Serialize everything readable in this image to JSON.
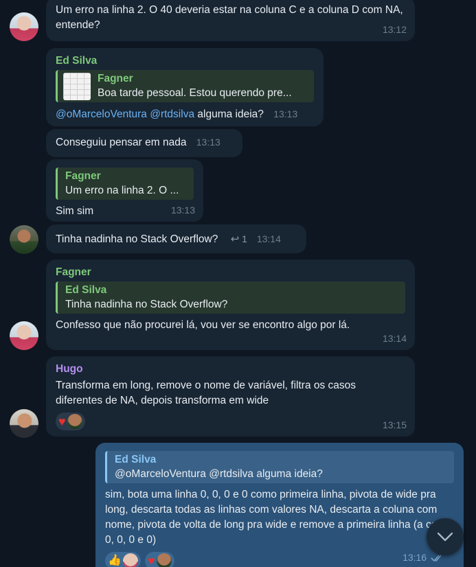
{
  "messages": [
    {
      "id": "m1",
      "text": "Um erro na linha 2. O 40 deveria estar na coluna C e a coluna D com NA, entende?",
      "time": "13:12"
    },
    {
      "id": "m2",
      "sender": "Ed Silva",
      "reply_name": "Fagner",
      "reply_text": "Boa tarde pessoal. Estou querendo pre...",
      "mention1": "@oMarceloVentura",
      "mention2": "@rtdsilva",
      "text": "alguma ideia?",
      "time": "13:13"
    },
    {
      "id": "m3",
      "text": "Conseguiu pensar em nada",
      "time": "13:13"
    },
    {
      "id": "m4",
      "reply_name": "Fagner",
      "reply_text": "Um erro na linha 2. O ...",
      "text": "Sim sim",
      "time": "13:13"
    },
    {
      "id": "m5",
      "text": "Tinha nadinha no Stack Overflow?",
      "reply_count": "1",
      "time": "13:14"
    },
    {
      "id": "m6",
      "sender": "Fagner",
      "reply_name": "Ed Silva",
      "reply_text": "Tinha nadinha no Stack Overflow?",
      "text": "Confesso que não procurei lá, vou ver se encontro algo por lá.",
      "time": "13:14"
    },
    {
      "id": "m7",
      "sender": "Hugo",
      "text": "Transforma em long, remove o nome de variável, filtra os casos diferentes de NA, depois transforma em wide",
      "reaction": "heart",
      "time": "13:15"
    },
    {
      "id": "m8",
      "reply_name": "Ed Silva",
      "reply_text": "@oMarceloVentura @rtdsilva alguma ideia?",
      "text": "sim, bota uma linha 0, 0, 0 e 0 como primeira linha, pivota de wide pra long, descarta todas as linhas com valores NA, descarta a coluna com nome, pivota de volta de long pra wide e remove a primeira linha (a com 0, 0, 0 e 0)",
      "time": "13:16"
    }
  ],
  "icons": {
    "reply_arrow": "reply-arrow-icon",
    "heart": "heart-icon",
    "thumbs_up": "thumbs-up-icon",
    "scroll_down": "chevron-down-icon",
    "read": "double-check-icon"
  },
  "colors": {
    "background": "#0e1621",
    "incoming_bubble": "#182533",
    "outgoing_bubble": "#2b5278",
    "sender_green": "#7ec97a",
    "sender_purple": "#b48ff0",
    "mention": "#6ab3f3"
  }
}
